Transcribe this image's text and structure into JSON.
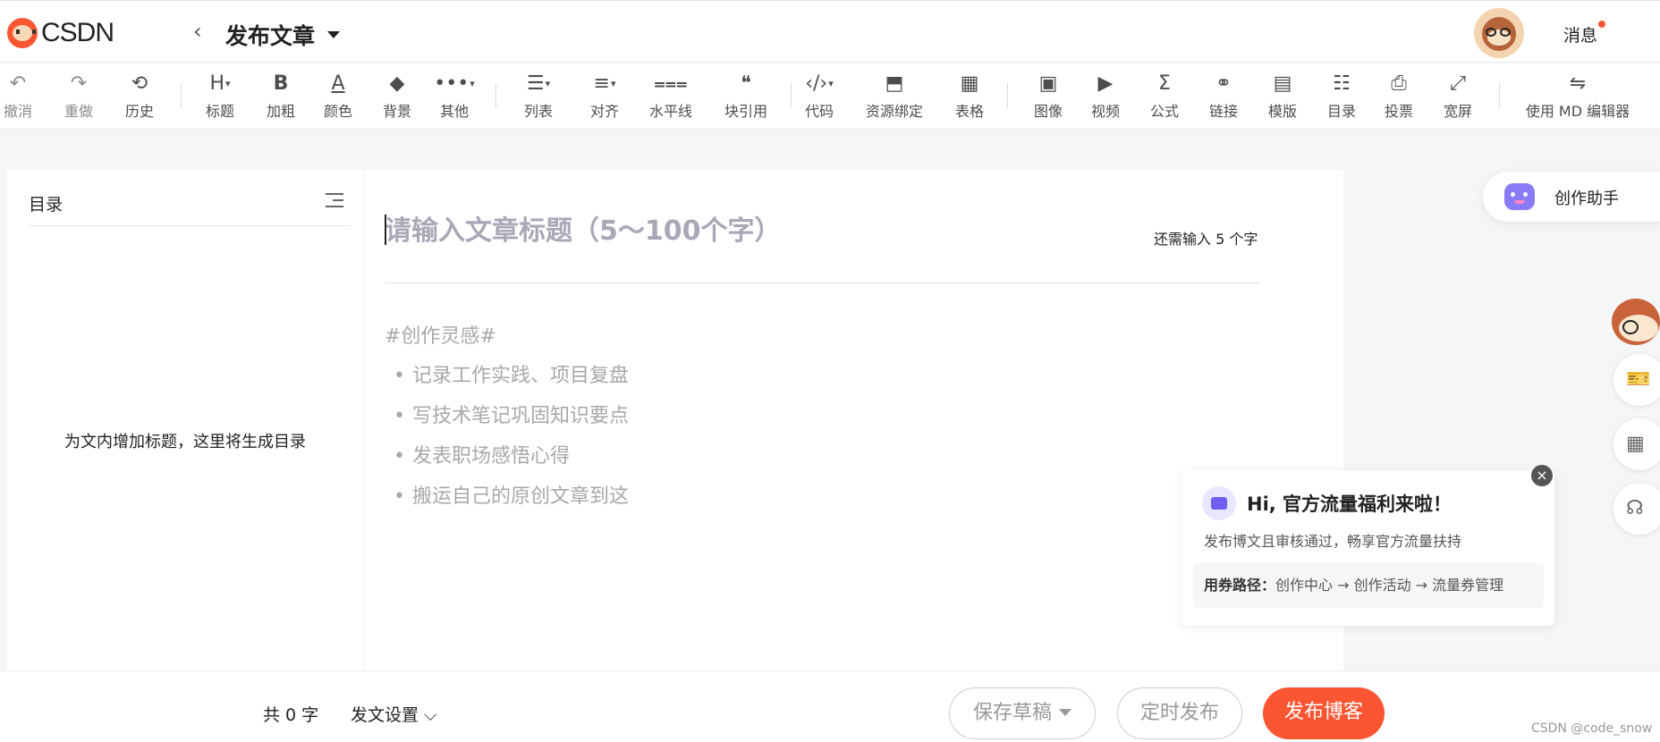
{
  "header": {
    "logo_text": "CSDN",
    "back_glyph": "‹",
    "title": "发布文章",
    "messages_label": "消息"
  },
  "toolbar": [
    {
      "label": "撤消",
      "icon": "undo-icon",
      "glyph": "↶"
    },
    {
      "label": "重做",
      "icon": "redo-icon",
      "glyph": "↷"
    },
    {
      "label": "历史",
      "icon": "history-icon",
      "glyph": "⟲"
    },
    {
      "label": "标题",
      "icon": "heading-icon",
      "glyph": "H"
    },
    {
      "label": "加粗",
      "icon": "bold-icon",
      "glyph": "B"
    },
    {
      "label": "颜色",
      "icon": "color-icon",
      "glyph": "A"
    },
    {
      "label": "背景",
      "icon": "background-icon",
      "glyph": "◆"
    },
    {
      "label": "其他",
      "icon": "more-icon",
      "glyph": "•••"
    },
    {
      "label": "列表",
      "icon": "list-icon",
      "glyph": "☰"
    },
    {
      "label": "对齐",
      "icon": "align-icon",
      "glyph": "≡"
    },
    {
      "label": "水平线",
      "icon": "horizontal-line-icon",
      "glyph": "⩶"
    },
    {
      "label": "块引用",
      "icon": "blockquote-icon",
      "glyph": "❝"
    },
    {
      "label": "代码",
      "icon": "code-icon",
      "glyph": "‹/›"
    },
    {
      "label": "资源绑定",
      "icon": "resource-icon",
      "glyph": "⬒"
    },
    {
      "label": "表格",
      "icon": "table-icon",
      "glyph": "▦"
    },
    {
      "label": "图像",
      "icon": "image-icon",
      "glyph": "▣"
    },
    {
      "label": "视频",
      "icon": "video-icon",
      "glyph": "▶"
    },
    {
      "label": "公式",
      "icon": "formula-icon",
      "glyph": "Σ"
    },
    {
      "label": "链接",
      "icon": "link-icon",
      "glyph": "⚭"
    },
    {
      "label": "模版",
      "icon": "template-icon",
      "glyph": "▤"
    },
    {
      "label": "目录",
      "icon": "toc-icon",
      "glyph": "☷"
    },
    {
      "label": "投票",
      "icon": "vote-icon",
      "glyph": "⎙"
    },
    {
      "label": "宽屏",
      "icon": "widescreen-icon",
      "glyph": "⤢"
    },
    {
      "label": "使用 MD 编辑器",
      "icon": "switch-icon",
      "glyph": "⇋"
    }
  ],
  "toc": {
    "title": "目录",
    "empty_text": "为文内增加标题，这里将生成目录"
  },
  "editor": {
    "title_placeholder": "请输入文章标题（5～100个字）",
    "count_hint": "还需输入 5 个字",
    "hint_tag": "#创作灵感#",
    "hint_items": [
      "记录工作实践、项目复盘",
      "写技术笔记巩固知识要点",
      "发表职场感悟心得",
      "搬运自己的原创文章到这"
    ]
  },
  "assistant": {
    "label": "创作助手"
  },
  "side_icons": [
    "coupon-icon",
    "qrcode-icon",
    "headset-icon"
  ],
  "popup": {
    "heading": "Hi, 官方流量福利来啦！",
    "desc": "发布博文且审核通过，畅享官方流量扶持",
    "route_label": "用券路径：",
    "route": "创作中心 → 创作活动 → 流量券管理",
    "close": "×"
  },
  "bottom": {
    "word_count": "共 0 字",
    "settings": "发文设置",
    "save_draft": "保存草稿",
    "schedule": "定时发布",
    "publish": "发布博客",
    "watermark": "CSDN @code_snow"
  },
  "colors": {
    "brand": "#fc5531",
    "muted": "#999aaa"
  }
}
